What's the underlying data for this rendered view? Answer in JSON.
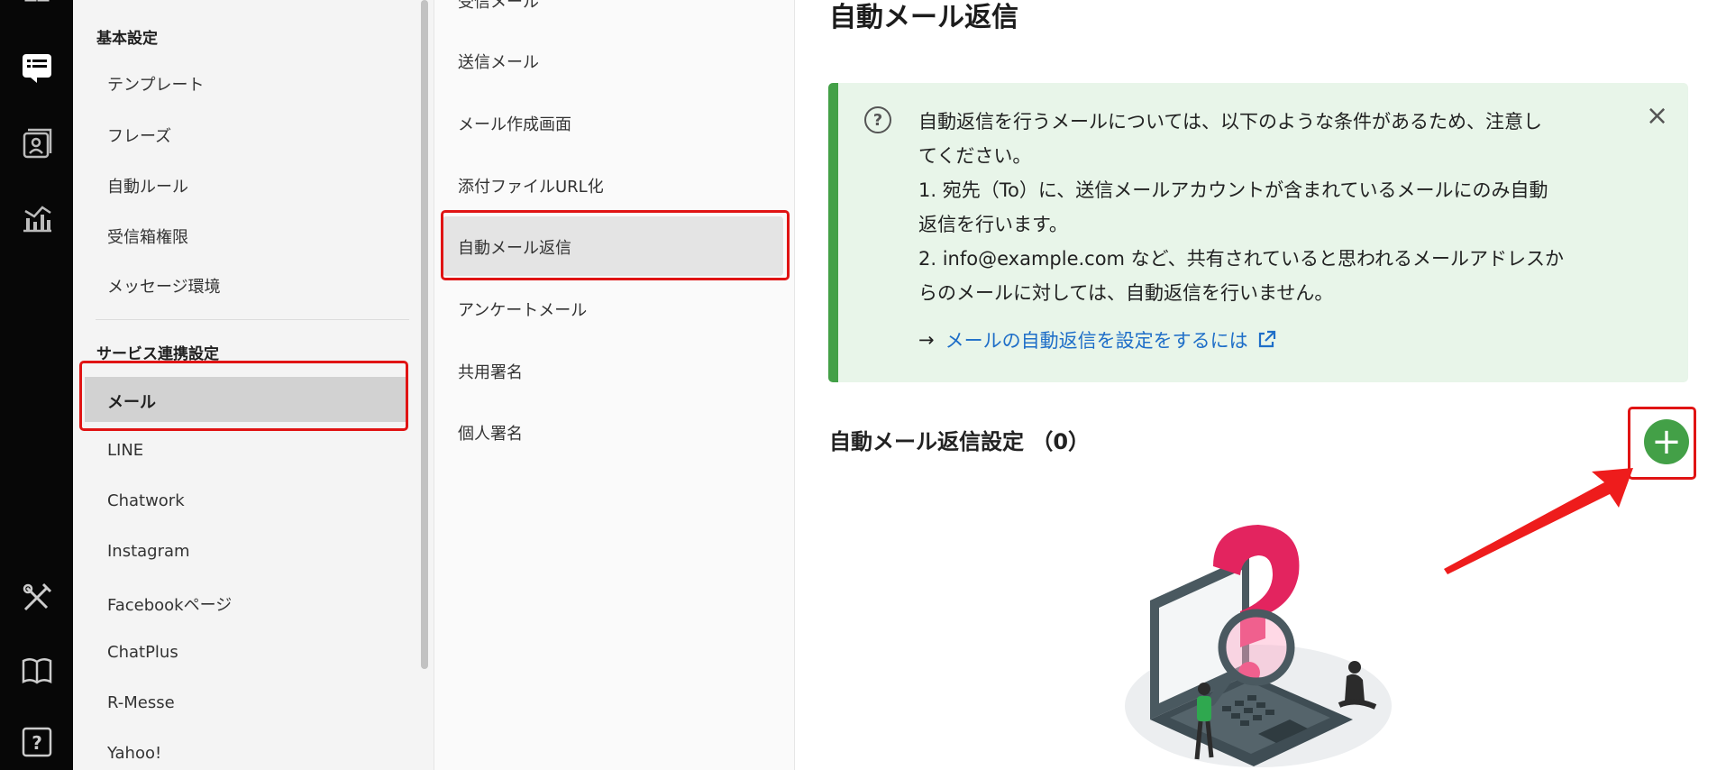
{
  "rail_icons": [
    "grid-icon",
    "message-board-icon",
    "contacts-icon",
    "analytics-icon",
    "tools-icon",
    "book-icon",
    "help-icon"
  ],
  "sidebar": {
    "section_basic": "基本設定",
    "basic_items": [
      "テンプレート",
      "フレーズ",
      "自動ルール",
      "受信箱権限",
      "メッセージ環境"
    ],
    "section_service": "サービス連携設定",
    "service_items": [
      "メール",
      "LINE",
      "Chatwork",
      "Instagram",
      "Facebookページ",
      "ChatPlus",
      "R-Messe",
      "Yahoo!"
    ],
    "active_item": "メール"
  },
  "submenu": {
    "items": [
      "受信メール",
      "送信メール",
      "メール作成画面",
      "添付ファイルURL化",
      "自動メール返信",
      "アンケートメール",
      "共用署名",
      "個人署名"
    ],
    "active_item": "自動メール返信"
  },
  "main": {
    "title": "自動メール返信",
    "notice": {
      "lines": [
        "自動返信を行うメールについては、以下のような条件があるため、注意し",
        "てください。",
        "1. 宛先（To）に、送信メールアカウントが含まれているメールにのみ自動",
        "返信を行います。",
        "2. info@example.com など、共有されていると思われるメールアドレスか",
        "らのメールに対しては、自動返信を行いません。"
      ],
      "link_arrow": "→",
      "link_text": "メールの自動返信を設定をするには",
      "close_symbol": "×",
      "help_symbol": "?"
    },
    "settings_title": "自動メール返信設定 （0）",
    "add_symbol": "+"
  },
  "colors": {
    "accent_green": "#43a047",
    "notice_bg": "#e8f5e9",
    "link_blue": "#1e6ec8",
    "highlight_red": "#e01414"
  }
}
